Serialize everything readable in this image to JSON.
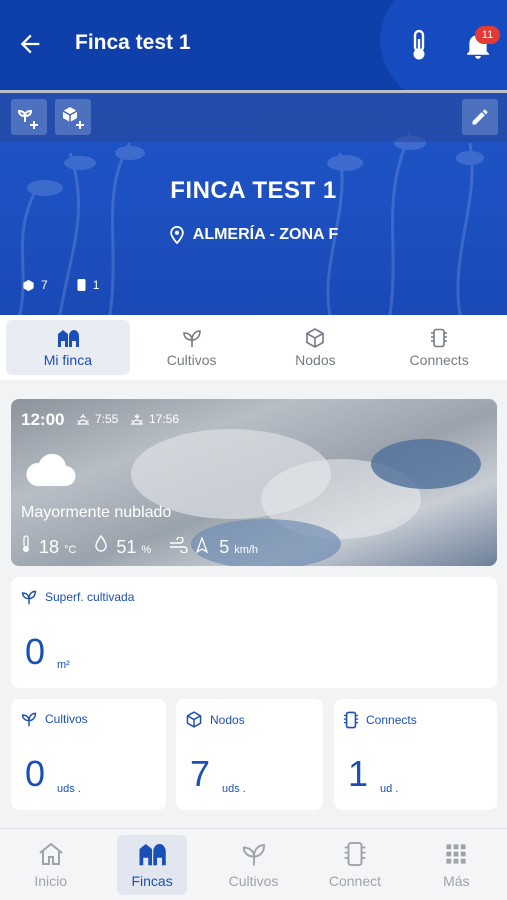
{
  "appbar": {
    "title": "Finca test 1",
    "notifications_count": "11",
    "back_icon": "arrow-left-icon",
    "thermometer_icon": "thermometer-icon",
    "bell_icon": "bell-icon"
  },
  "hero": {
    "farm_name": "FINCA TEST 1",
    "location": "ALMERÍA - ZONA F",
    "nodes_count": "7",
    "connects_count": "1"
  },
  "tabs": [
    {
      "label": "Mi finca",
      "icon": "farm-icon",
      "active": true
    },
    {
      "label": "Cultivos",
      "icon": "sprout-icon",
      "active": false
    },
    {
      "label": "Nodos",
      "icon": "cube-icon",
      "active": false
    },
    {
      "label": "Connects",
      "icon": "chip-icon",
      "active": false
    }
  ],
  "weather": {
    "time": "12:00",
    "sunrise": "7:55",
    "sunset": "17:56",
    "description": "Mayormente nublado",
    "temperature": "18",
    "temperature_unit": "°C",
    "humidity": "51",
    "humidity_unit": "%",
    "wind": "5",
    "wind_unit": "km/h"
  },
  "cards": {
    "surface": {
      "label": "Superf. cultivada",
      "value": "0",
      "unit": "m²"
    },
    "crops": {
      "label": "Cultivos",
      "value": "0",
      "unit": "uds ."
    },
    "nodes": {
      "label": "Nodos",
      "value": "7",
      "unit": "uds ."
    },
    "connects": {
      "label": "Connects",
      "value": "1",
      "unit": "ud ."
    }
  },
  "bottomnav": [
    {
      "label": "Inicio",
      "icon": "home-icon",
      "active": false
    },
    {
      "label": "Fincas",
      "icon": "farm-icon",
      "active": true
    },
    {
      "label": "Cultivos",
      "icon": "sprout-icon",
      "active": false
    },
    {
      "label": "Connect",
      "icon": "device-icon",
      "active": false
    },
    {
      "label": "Más",
      "icon": "grid-icon",
      "active": false
    }
  ],
  "colors": {
    "primary": "#0f3fa8",
    "accent": "#1b4fb8",
    "badge": "#e53935"
  }
}
